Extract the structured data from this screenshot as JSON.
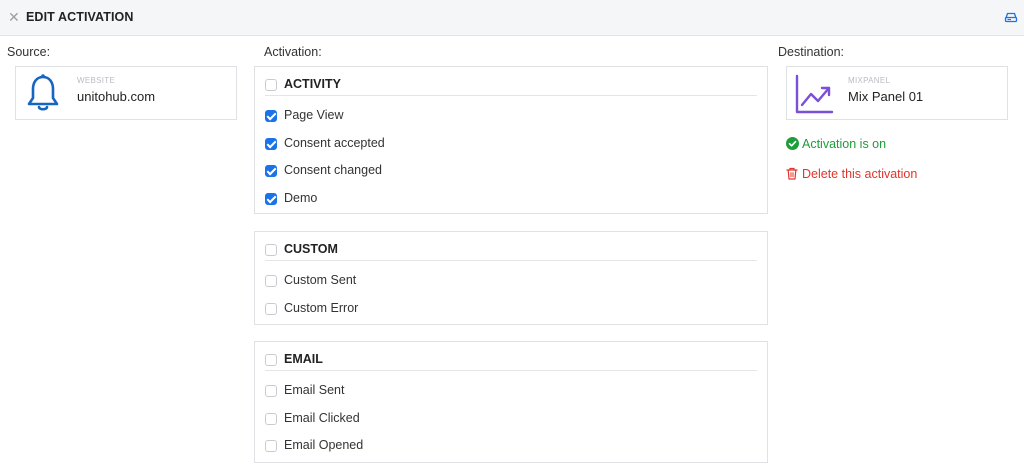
{
  "header": {
    "close_icon": "close-icon",
    "title": "EDIT ACTIVATION",
    "right_icon": "drive-icon"
  },
  "source": {
    "label": "Source:",
    "type": "WEBSITE",
    "name": "unitohub.com",
    "icon": "bell-icon",
    "icon_color": "#1665c0"
  },
  "activation": {
    "label": "Activation:",
    "groups": [
      {
        "title": "ACTIVITY",
        "checked": false,
        "items": [
          {
            "label": "Page View",
            "checked": true
          },
          {
            "label": "Consent accepted",
            "checked": true
          },
          {
            "label": "Consent changed",
            "checked": true
          },
          {
            "label": "Demo",
            "checked": true
          }
        ]
      },
      {
        "title": "CUSTOM",
        "checked": false,
        "items": [
          {
            "label": "Custom Sent",
            "checked": false
          },
          {
            "label": "Custom Error",
            "checked": false
          }
        ]
      },
      {
        "title": "EMAIL",
        "checked": false,
        "items": [
          {
            "label": "Email Sent",
            "checked": false
          },
          {
            "label": "Email Clicked",
            "checked": false
          },
          {
            "label": "Email Opened",
            "checked": false
          }
        ]
      }
    ]
  },
  "destination": {
    "label": "Destination:",
    "type": "MIXPANEL",
    "name": "Mix Panel 01",
    "icon": "chart-trend-icon",
    "icon_color": "#7b4fd6"
  },
  "status": {
    "text": "Activation is on",
    "color": "#1e9d3a",
    "icon": "check-circle-icon"
  },
  "delete": {
    "text": "Delete this activation",
    "color": "#e0352b",
    "icon": "trash-icon"
  }
}
